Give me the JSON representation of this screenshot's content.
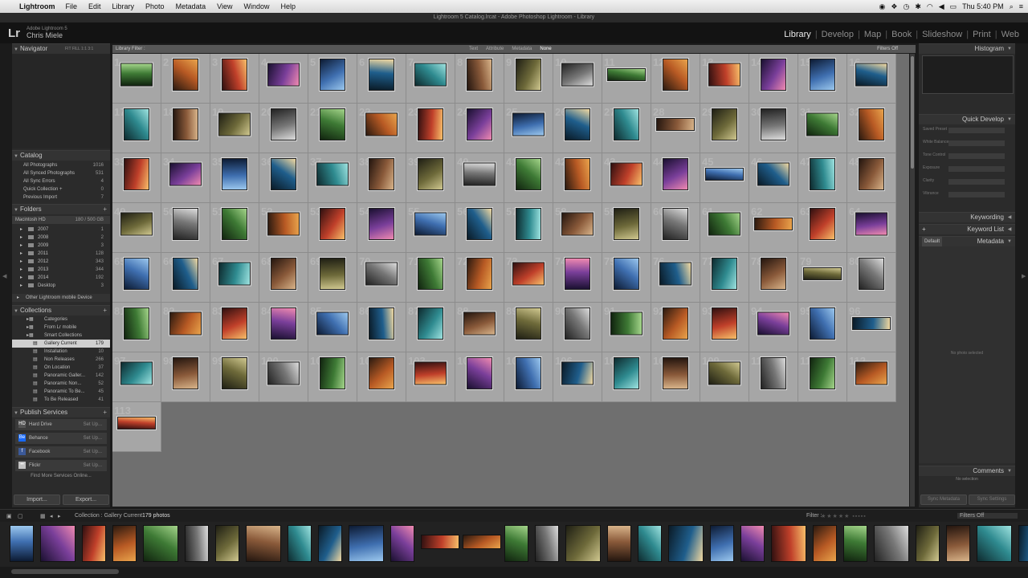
{
  "menubar": {
    "app": "Lightroom",
    "items": [
      "File",
      "Edit",
      "Library",
      "Photo",
      "Metadata",
      "View",
      "Window",
      "Help"
    ],
    "clock": "Thu 5:40 PM"
  },
  "window_title": "Lightroom 5 Catalog.lrcat - Adobe Photoshop Lightroom - Library",
  "identity": {
    "logo": "Lr",
    "product": "Adobe Lightroom 5",
    "user": "Chris Miele"
  },
  "modules": [
    {
      "label": "Library",
      "active": true
    },
    {
      "label": "Develop",
      "active": false
    },
    {
      "label": "Map",
      "active": false
    },
    {
      "label": "Book",
      "active": false
    },
    {
      "label": "Slideshow",
      "active": false
    },
    {
      "label": "Print",
      "active": false
    },
    {
      "label": "Web",
      "active": false
    }
  ],
  "left": {
    "navigator": {
      "title": "Navigator",
      "modes": [
        "FIT",
        "FILL",
        "1:1",
        "3:1"
      ]
    },
    "catalog": {
      "title": "Catalog",
      "items": [
        {
          "label": "All Photographs",
          "count": "1016"
        },
        {
          "label": "All Synced Photographs",
          "count": "531"
        },
        {
          "label": "All Sync Errors",
          "count": "4"
        },
        {
          "label": "Quick Collection +",
          "count": "0"
        },
        {
          "label": "Previous Import",
          "count": "7"
        }
      ]
    },
    "folders": {
      "title": "Folders",
      "volume": "Macintosh HD",
      "volume_info": "180 / 500 GB",
      "items": [
        {
          "label": "2007",
          "count": "1"
        },
        {
          "label": "2008",
          "count": "2"
        },
        {
          "label": "2009",
          "count": "3"
        },
        {
          "label": "2011",
          "count": "128"
        },
        {
          "label": "2012",
          "count": "343"
        },
        {
          "label": "2013",
          "count": "344"
        },
        {
          "label": "2014",
          "count": "192"
        },
        {
          "label": "Desktop",
          "count": "3"
        }
      ],
      "other": "Other Lightroom mobile Device"
    },
    "collections": {
      "title": "Collections",
      "items": [
        {
          "label": "Categories",
          "count": ""
        },
        {
          "label": "From Lr mobile",
          "count": ""
        },
        {
          "label": "Smart Collections",
          "count": ""
        },
        {
          "label": "Gallery Current",
          "count": "179"
        },
        {
          "label": "Installation",
          "count": "10"
        },
        {
          "label": "Non Releases",
          "count": "266"
        },
        {
          "label": "On Location",
          "count": "37"
        },
        {
          "label": "Panoramic Galler...",
          "count": "142"
        },
        {
          "label": "Panoramic Non...",
          "count": "52"
        },
        {
          "label": "Panoramic To Be...",
          "count": "45"
        },
        {
          "label": "To Be Released",
          "count": "41"
        }
      ]
    },
    "publish": {
      "title": "Publish Services",
      "items": [
        {
          "label": "Hard Drive",
          "icon": "HD",
          "color": "#555555"
        },
        {
          "label": "Behance",
          "icon": "Be",
          "color": "#1769ff"
        },
        {
          "label": "Facebook",
          "icon": "f",
          "color": "#3b5998"
        },
        {
          "label": "Flickr",
          "icon": "••",
          "color": "#c2c2c2"
        }
      ],
      "setup": "Set Up...",
      "find": "Find More Services Online..."
    },
    "import_label": "Import...",
    "export_label": "Export..."
  },
  "filterbar": {
    "title": "Library Filter :",
    "options": [
      "Text",
      "Attribute",
      "Metadata",
      "None"
    ],
    "active": "None",
    "filters_off": "Filters Off"
  },
  "grid": {
    "count": 113
  },
  "right": {
    "histogram": "Histogram",
    "quick_develop": "Quick Develop",
    "qd_rows": [
      "Saved Preset",
      "White Balance",
      "Tone Control",
      "Exposure",
      "Clarity",
      "Vibrance"
    ],
    "keywording": "Keywording",
    "keyword_list": "Keyword List",
    "metadata": "Metadata",
    "metadata_preset": "Default",
    "no_photo": "No photo selected",
    "comments": "Comments",
    "no_selection": "No selection",
    "sync_meta": "Sync Metadata",
    "sync_settings": "Sync Settings"
  },
  "toolbar": {
    "source": "Collection : Gallery Current",
    "count": "179 photos",
    "filter_label": "Filter :",
    "filters_off": "Filters Off"
  },
  "colors": {
    "grid_bg": "#6f6f6f",
    "cell_bg": "#a6a6a6",
    "panel_bg": "#2b2b2b",
    "accent": "#eaeaea"
  }
}
